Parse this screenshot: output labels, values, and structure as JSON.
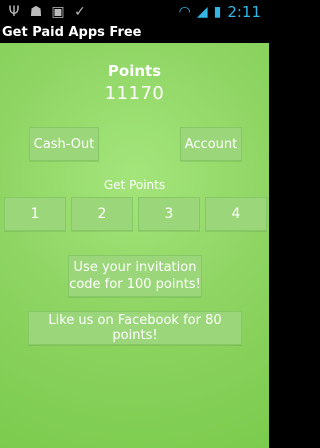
{
  "status_bar": {
    "time": "2:11",
    "icons": [
      "usb-icon",
      "android-debug-icon",
      "image-icon",
      "check-icon",
      "wifi-icon",
      "signal-icon",
      "battery-icon"
    ]
  },
  "app": {
    "title": "Get Paid Apps Free"
  },
  "main": {
    "points_label": "Points",
    "points_value": "11170",
    "cashout_label": "Cash-Out",
    "account_label": "Account",
    "get_points_label": "Get Points",
    "options": [
      "1",
      "2",
      "3",
      "4"
    ],
    "invite_label": "Use your invitation code for 100 points!",
    "facebook_label": "Like us on Facebook for 80 points!"
  },
  "colors": {
    "background": "#8fd564",
    "button": "#9bd77a",
    "text": "#ffffff",
    "status_accent": "#33b5e5"
  }
}
